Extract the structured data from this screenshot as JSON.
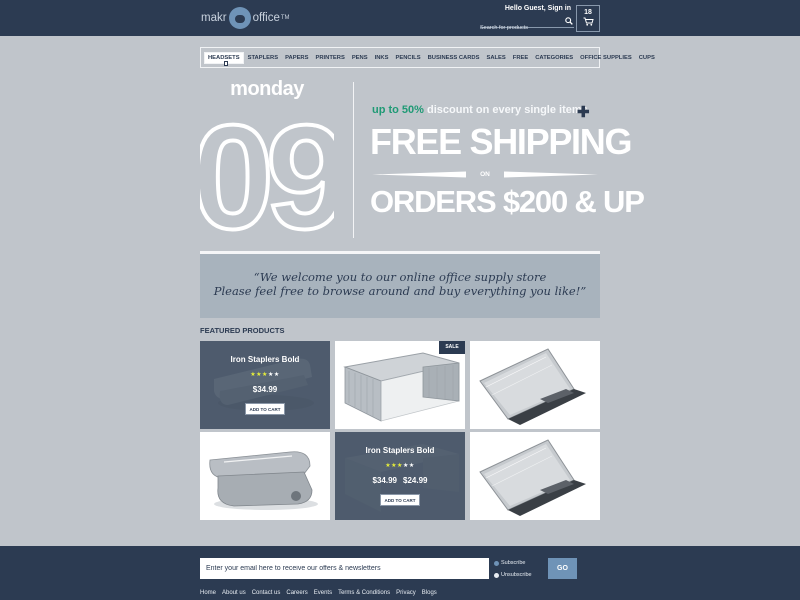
{
  "header": {
    "logo_left": "makr",
    "logo_right": "office",
    "logo_tm": "TM",
    "greeting": "Hello Guest, Sign in",
    "search_placeholder": "Search for products",
    "cart_count": "18"
  },
  "nav": {
    "items": [
      "HEADSETS",
      "STAPLERS",
      "PAPERS",
      "PRINTERS",
      "PENS",
      "INKS",
      "PENCILS",
      "BUSINESS CARDS",
      "SALES",
      "FREE",
      "CATEGORIES",
      "OFFICE SUPPLIES",
      "CUPS"
    ],
    "active": "HEADSETS"
  },
  "hero": {
    "day": "monday",
    "date": "09",
    "promo_accent": "up to 50%",
    "promo_rest": " discount on every single items",
    "headline": "FREE SHIPPING",
    "on": "ON",
    "subline": "ORDERS $200 & UP"
  },
  "welcome": {
    "line1": "“We welcome you to our online office supply store",
    "line2": "Please feel free to browse around and buy everything you like!”"
  },
  "featured": {
    "title": "FEATURED PRODUCTS",
    "products": [
      {
        "name": "Iron Staplers Bold",
        "rating": 3,
        "rating_max": 5,
        "price": "$34.99",
        "button": "ADD TO CART",
        "image": "stapler"
      },
      {
        "image": "glass-desk",
        "badge": "SALE"
      },
      {
        "image": "laptop"
      },
      {
        "image": "stapler"
      },
      {
        "name": "Iron Staplers Bold",
        "rating": 3,
        "rating_max": 5,
        "old_price": "$34.99",
        "price": "$24.99",
        "button": "ADD TO CART",
        "image": "glass-desk"
      },
      {
        "image": "laptop"
      }
    ]
  },
  "footer": {
    "email_placeholder": "Enter your email here to receive our offers & newsletters",
    "subscribe": "Subscribe",
    "unsubscribe": "Unsubscribe",
    "go": "GO",
    "links": [
      "Home",
      "About us",
      "Contact us",
      "Careers",
      "Events",
      "Terms & Conditions",
      "Privacy",
      "Blogs"
    ]
  },
  "colors": {
    "navy": "#2c3b52",
    "background": "#c0c5cb",
    "accent_green": "#1f9a75",
    "button_blue": "#6f93b7",
    "star_yellow": "#e6ee3a"
  }
}
